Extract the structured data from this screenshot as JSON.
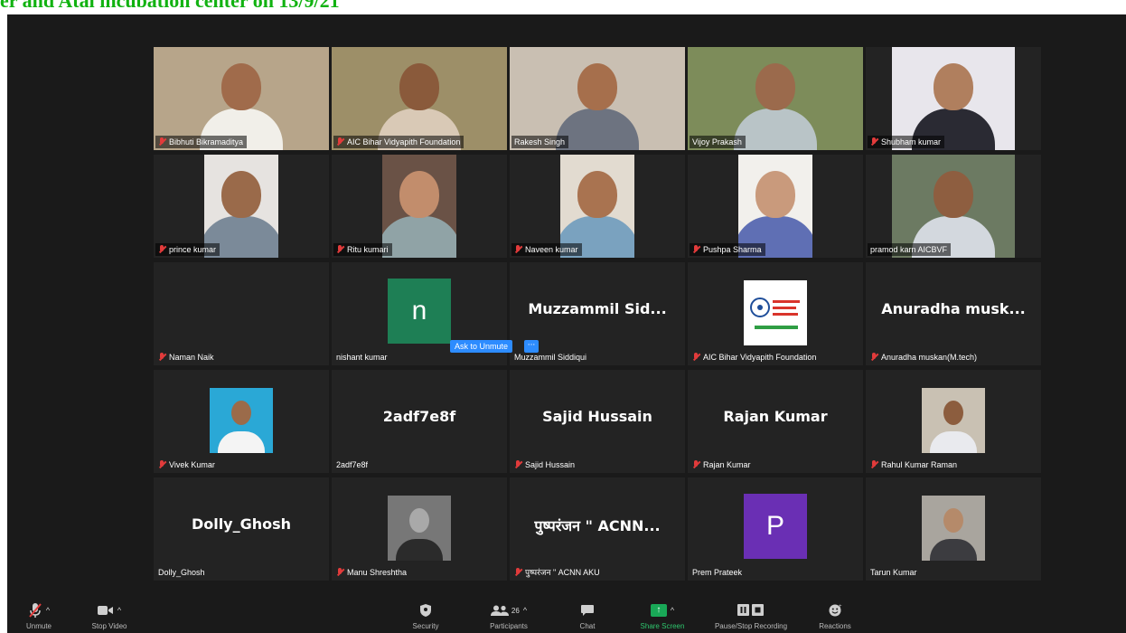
{
  "banner": {
    "text": "er and Atal incubation center  on 13/9/21"
  },
  "ask_unmute": {
    "label": "Ask to Unmute",
    "more": "···"
  },
  "tiles": [
    {
      "name": "Bibhuti Bikramaditya",
      "kind": "video",
      "bg": "#b7a58a",
      "shirt": "#f1efe9",
      "skin": "#a06b4b",
      "muted": true
    },
    {
      "name": "AIC Bihar Vidyapith Foundation",
      "kind": "video",
      "bg": "#9d8f68",
      "shirt": "#d9c9b6",
      "skin": "#8a5a3b",
      "muted": true
    },
    {
      "name": "Rakesh Singh",
      "kind": "video",
      "bg": "#c9bfb2",
      "shirt": "#6d7380",
      "skin": "#a66f4c",
      "muted": false,
      "active": true
    },
    {
      "name": "Vijoy Prakash",
      "kind": "video",
      "bg": "#7d8c5a",
      "shirt": "#b9c4c7",
      "skin": "#9b6a4c",
      "muted": false
    },
    {
      "name": "Shubham kumar",
      "kind": "video",
      "bg": "#e8e6ec",
      "shirt": "#2a2a33",
      "skin": "#b07f5e",
      "muted": true
    },
    {
      "name": "prince kumar",
      "kind": "video",
      "bg": "#e6e3e0",
      "shirt": "#7b8a99",
      "skin": "#9a6a4a",
      "muted": true
    },
    {
      "name": "Ritu kumari",
      "kind": "video",
      "bg": "#6a5246",
      "shirt": "#90a3a6",
      "skin": "#c28d6c",
      "muted": true
    },
    {
      "name": "Naveen kumar",
      "kind": "video",
      "bg": "#e2dbd0",
      "shirt": "#7aa2bf",
      "skin": "#a97350",
      "muted": true
    },
    {
      "name": "Pushpa Sharma",
      "kind": "video",
      "bg": "#f2f0ec",
      "shirt": "#5f6fb4",
      "skin": "#c99a7c",
      "muted": true
    },
    {
      "name": "pramod karn AICBVF",
      "kind": "video",
      "bg": "#6c7a62",
      "shirt": "#d3d8de",
      "skin": "#8e5e40",
      "muted": false
    },
    {
      "name": "Naman Naik",
      "kind": "blank",
      "muted": true
    },
    {
      "name": "nishant kumar",
      "kind": "letter",
      "letter": "n",
      "avatar_color": "#1e7f55",
      "muted": false
    },
    {
      "name": "Muzzammil Siddiqui",
      "kind": "text",
      "display": "Muzzammil  Sid...",
      "muted": false
    },
    {
      "name": "AIC Bihar Vidyapith Foundation",
      "kind": "logo",
      "muted": true
    },
    {
      "name": "Anuradha muskan(M.tech)",
      "kind": "text",
      "display": "Anuradha  musk...",
      "muted": true
    },
    {
      "name": "Vivek Kumar",
      "kind": "photo",
      "photo_bg": "#2aa8d6",
      "shirt": "#f4f4f4",
      "skin": "#9b6b4a",
      "muted": true
    },
    {
      "name": "2adf7e8f",
      "kind": "text",
      "display": "2adf7e8f",
      "muted": false
    },
    {
      "name": "Sajid Hussain",
      "kind": "text",
      "display": "Sajid Hussain",
      "muted": true
    },
    {
      "name": "Rajan Kumar",
      "kind": "text",
      "display": "Rajan Kumar",
      "muted": true
    },
    {
      "name": "Rahul Kumar Raman",
      "kind": "photo",
      "photo_bg": "#c9c1b3",
      "shirt": "#e9eaee",
      "skin": "#8c5d3e",
      "muted": true
    },
    {
      "name": "Dolly_Ghosh",
      "kind": "text",
      "display": "Dolly_Ghosh",
      "muted": false
    },
    {
      "name": "Manu Shreshtha",
      "kind": "photo",
      "photo_bg": "#777777",
      "shirt": "#2b2b2b",
      "skin": "#a9a9a9",
      "muted": true
    },
    {
      "name": "पुष्परंजन \" ACNN AKU",
      "kind": "text",
      "display": "पुष्परंजन \" ACNN...",
      "muted": true
    },
    {
      "name": "Prem Prateek",
      "kind": "letter",
      "letter": "P",
      "avatar_color": "#6a2fb4",
      "muted": false
    },
    {
      "name": "Tarun Kumar",
      "kind": "photo",
      "photo_bg": "#a9a59e",
      "shirt": "#3c3c40",
      "skin": "#b58a6a",
      "muted": false
    }
  ],
  "toolbar": {
    "unmute": "Unmute",
    "stop_video": "Stop Video",
    "security": "Security",
    "participants": "Participants",
    "participants_count": "26",
    "chat": "Chat",
    "share_screen": "Share Screen",
    "pause_recording": "Pause/Stop Recording",
    "reactions": "Reactions",
    "colors": {
      "share": "#2ec66d",
      "mute_red": "#e23b3b"
    }
  }
}
